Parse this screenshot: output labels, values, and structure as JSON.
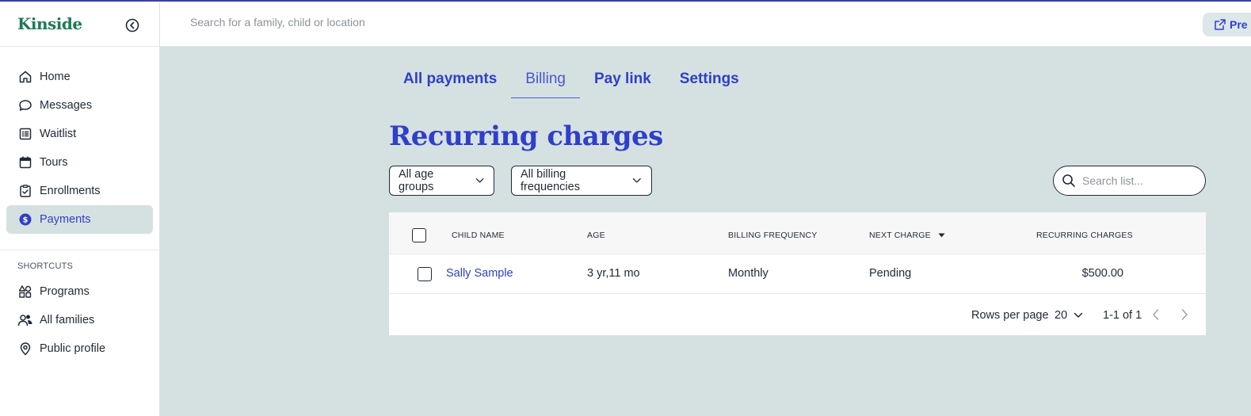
{
  "app": {
    "logo": "Kinside"
  },
  "sidebar": {
    "items": [
      {
        "label": "Home",
        "icon": "home-icon"
      },
      {
        "label": "Messages",
        "icon": "message-icon"
      },
      {
        "label": "Waitlist",
        "icon": "list-icon"
      },
      {
        "label": "Tours",
        "icon": "calendar-icon"
      },
      {
        "label": "Enrollments",
        "icon": "clipboard-check-icon"
      },
      {
        "label": "Payments",
        "icon": "dollar-circle-icon",
        "active": true
      }
    ],
    "shortcuts_label": "SHORTCUTS",
    "shortcuts": [
      {
        "label": "Programs",
        "icon": "shapes-icon"
      },
      {
        "label": "All families",
        "icon": "users-icon"
      },
      {
        "label": "Public profile",
        "icon": "location-pin-icon"
      }
    ]
  },
  "topbar": {
    "search_placeholder": "Search for a family, child or location",
    "preview_label": "Pre"
  },
  "tabs": [
    {
      "label": "All payments",
      "active": false
    },
    {
      "label": "Billing",
      "active": true
    },
    {
      "label": "Pay link",
      "active": false
    },
    {
      "label": "Settings",
      "active": false
    }
  ],
  "page": {
    "title": "Recurring charges"
  },
  "filters": {
    "age_groups": "All age groups",
    "billing_frequencies": "All billing frequencies"
  },
  "list_search": {
    "placeholder": "Search list..."
  },
  "table": {
    "columns": [
      "CHILD NAME",
      "AGE",
      "BILLING FREQUENCY",
      "NEXT CHARGE",
      "RECURRING CHARGES"
    ],
    "rows": [
      {
        "child_name": "Sally Sample",
        "age": "3 yr,11 mo",
        "billing_frequency": "Monthly",
        "next_charge": "Pending",
        "recurring_charges": "$500.00"
      }
    ],
    "footer": {
      "rows_per_page_label": "Rows per page",
      "rows_per_page": "20",
      "range": "1-1 of 1"
    }
  },
  "colors": {
    "accent": "#2f3fc9",
    "brand": "#1d7a55",
    "background": "#d5e1e1"
  }
}
